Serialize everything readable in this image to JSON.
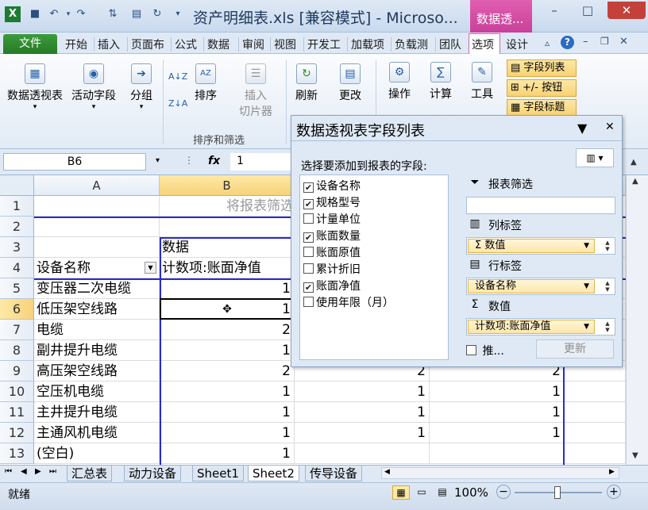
{
  "window": {
    "title": "资产明细表.xls  [兼容模式] - Microso...",
    "context_tab": "数据透...",
    "min": "–",
    "max": "□",
    "close": "✕"
  },
  "tabs": [
    "文件",
    "开始",
    "插入",
    "页面布",
    "公式",
    "数据",
    "审阅",
    "视图",
    "开发工",
    "加载项",
    "负载测",
    "团队",
    "选项",
    "设计"
  ],
  "ribbon": {
    "pivot_table": "数据透视表",
    "active_field": "活动字段",
    "group": "分组",
    "sort_az": "A↓Z",
    "sort_za": "Z↓A",
    "sort": "排序",
    "insert_slicer_1": "插入",
    "insert_slicer_2": "切片器",
    "sort_filter_group": "排序和筛选",
    "refresh": "刷新",
    "change": "更改",
    "actions": "操作",
    "calculations": "计算",
    "tools": "工具",
    "field_list": "字段列表",
    "plus_minus": "+/- 按钮",
    "field_headers": "字段标题"
  },
  "formula": {
    "name_box": "B6",
    "fx": "fx",
    "value": "1"
  },
  "columns": [
    "A",
    "B"
  ],
  "rows": [
    {
      "n": "1",
      "a": "",
      "b": "将报表筛选"
    },
    {
      "n": "2",
      "a": "",
      "b": ""
    },
    {
      "n": "3",
      "a": "",
      "b": "数据"
    },
    {
      "n": "4",
      "a": "设备名称",
      "b": "计数项:账面净值"
    },
    {
      "n": "5",
      "a": "变压器二次电缆",
      "b": "1",
      "c": "",
      "d": ""
    },
    {
      "n": "6",
      "a": "低压架空线路",
      "b": "1",
      "c": "",
      "d": ""
    },
    {
      "n": "7",
      "a": "电缆",
      "b": "2",
      "c": "",
      "d": ""
    },
    {
      "n": "8",
      "a": "副井提升电缆",
      "b": "1",
      "c": "",
      "d": ""
    },
    {
      "n": "9",
      "a": "高压架空线路",
      "b": "2",
      "c": "2",
      "d": "2"
    },
    {
      "n": "10",
      "a": "空压机电缆",
      "b": "1",
      "c": "1",
      "d": "1"
    },
    {
      "n": "11",
      "a": "主井提升电缆",
      "b": "1",
      "c": "1",
      "d": "1"
    },
    {
      "n": "12",
      "a": "主通风机电缆",
      "b": "1",
      "c": "1",
      "d": "1"
    },
    {
      "n": "13",
      "a": "(空白)",
      "b": "1",
      "c": "",
      "d": ""
    }
  ],
  "sheets": [
    "汇总表",
    "动力设备",
    "Sheet1",
    "Sheet2",
    "传导设备"
  ],
  "status": {
    "ready": "就绪",
    "zoom": "100%",
    "zoom_out": "−",
    "zoom_in": "+"
  },
  "pane": {
    "title": "数据透视表字段列表",
    "choose_label": "选择要添加到报表的字段:",
    "fields": [
      {
        "label": "设备名称",
        "checked": true
      },
      {
        "label": "规格型号",
        "checked": true
      },
      {
        "label": "计量单位",
        "checked": false
      },
      {
        "label": "账面数量",
        "checked": true
      },
      {
        "label": "账面原值",
        "checked": false
      },
      {
        "label": "累计折旧",
        "checked": false
      },
      {
        "label": "账面净值",
        "checked": true
      },
      {
        "label": "使用年限（月）",
        "checked": false
      }
    ],
    "report_filter": "报表筛选",
    "column_labels": "列标签",
    "column_item": "Σ  数值",
    "row_labels": "行标签",
    "row_item": "设备名称",
    "values": "数值",
    "values_item": "计数项:账面净值",
    "defer": "推...",
    "update": "更新"
  }
}
